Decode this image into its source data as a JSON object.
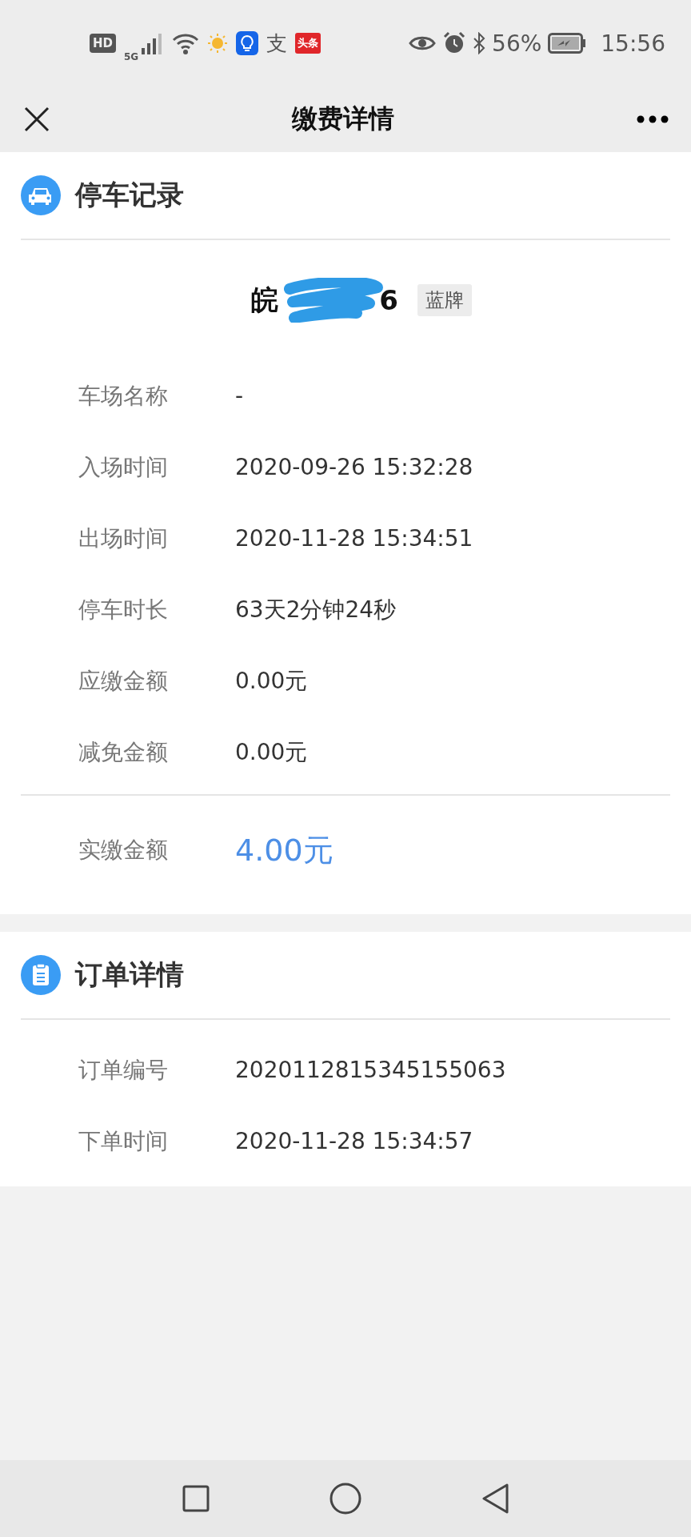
{
  "status_bar": {
    "left_texts": [
      "HD",
      "5G"
    ],
    "notifications": [
      "支",
      "头条"
    ],
    "battery_percent": "56%",
    "time": "15:56"
  },
  "nav": {
    "title": "缴费详情"
  },
  "sections": [
    {
      "title": "停车记录",
      "kind": "car",
      "plate": {
        "start": "皖",
        "end": "6",
        "redacted": true,
        "tag": "蓝牌"
      },
      "rows": [
        {
          "label": "车场名称",
          "value": "-"
        },
        {
          "label": "入场时间",
          "value": "2020-09-26 15:32:28"
        },
        {
          "label": "出场时间",
          "value": "2020-11-28 15:34:51"
        },
        {
          "label": "停车时长",
          "value": "63天2分钟24秒"
        },
        {
          "label": "应缴金额",
          "value": "0.00元"
        },
        {
          "label": "减免金额",
          "value": "0.00元"
        }
      ],
      "total": {
        "label": "实缴金额",
        "value": "4.00元"
      }
    },
    {
      "title": "订单详情",
      "kind": "clipboard",
      "rows": [
        {
          "label": "订单编号",
          "value": "2020112815345155063"
        },
        {
          "label": "下单时间",
          "value": "2020-11-28 15:34:57"
        }
      ]
    }
  ]
}
